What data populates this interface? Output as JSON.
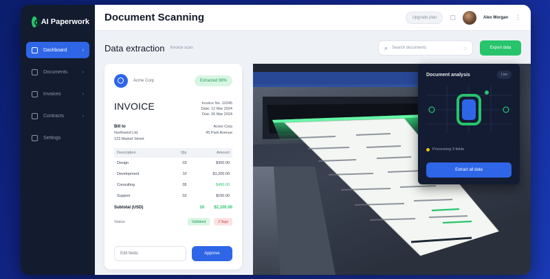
{
  "sidebar": {
    "logo_text": "AI Paperwork",
    "items": [
      {
        "label": "Dashboard",
        "active": true
      },
      {
        "label": "Documents"
      },
      {
        "label": "Invoices"
      },
      {
        "label": "Contracts"
      },
      {
        "label": "Settings"
      }
    ]
  },
  "topbar": {
    "title": "Document Scanning",
    "pill_label": "Upgrade plan",
    "user_name": "Alex Morgan"
  },
  "page": {
    "title": "Data extraction",
    "subtitle": "Invoice scan",
    "search_placeholder": "Search documents",
    "action_label": "Export data"
  },
  "invoice": {
    "company": "Acme Corp",
    "badge": "Extracted 98%",
    "title": "INVOICE",
    "meta": [
      "Invoice No. 10245",
      "Date: 12 Mar 2024",
      "Due: 26 Mar 2024"
    ],
    "bill_to_label": "Bill to",
    "bill_to_lines": [
      "Northwind Ltd.",
      "123 Market Street"
    ],
    "bill_from_lines": [
      "Acme Corp",
      "45 Park Avenue"
    ],
    "table": {
      "headers": [
        "Description",
        "Qty",
        "Amount"
      ],
      "rows": [
        [
          "Design",
          "03",
          "$300.00"
        ],
        [
          "Development",
          "10",
          "$1,200.00"
        ],
        [
          "Consulting",
          "05",
          "$450.00"
        ],
        [
          "Support",
          "02",
          "$150.00"
        ]
      ]
    },
    "subtotal_label": "Subtotal (USD)",
    "subtotal_qty": "20",
    "subtotal_value": "$2,100.00",
    "note_label": "Status",
    "note_tag_green": "Validated",
    "note_tag_red": "2 flags",
    "secondary_action": "Edit fields",
    "primary_action": "Approve"
  },
  "ai_panel": {
    "title": "Document analysis",
    "toggle": "Live",
    "status": "Processing 3 fields",
    "button": "Extract all data"
  },
  "colors": {
    "accent_blue": "#2f66e8",
    "accent_green": "#27c46b",
    "sidebar_bg": "#131b2f"
  }
}
